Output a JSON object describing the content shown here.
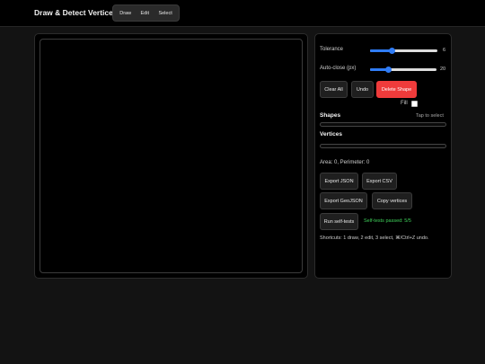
{
  "app": {
    "title": "Draw & Detect Vertices"
  },
  "modes": [
    {
      "label": "Draw"
    },
    {
      "label": "Edit"
    },
    {
      "label": "Select"
    }
  ],
  "controls": {
    "tolerance": {
      "label": "Tolerance",
      "value": "6",
      "level": 0.32
    },
    "autoclose": {
      "label": "Auto-close (px)",
      "value": "20",
      "level": 0.28
    },
    "clear_label": "Clear All",
    "undo_label": "Undo",
    "delete_label": "Delete Shape",
    "fill_label": "Fill"
  },
  "shapes": {
    "title": "Shapes",
    "hint": "Tap to select"
  },
  "vertices": {
    "title": "Vertices"
  },
  "metrics": {
    "text": "Area: 0, Perimeter: 0"
  },
  "exports": {
    "json_label": "Export JSON",
    "csv_label": "Export CSV",
    "geojson_label": "Export GeoJSON",
    "copy_label": "Copy vertices"
  },
  "tests": {
    "run_label": "Run self-tests",
    "status": "Self-tests passed: 5/5"
  },
  "shortcuts": {
    "text": "Shortcuts: 1 draw, 2 edit, 3 select, ⌘/Ctrl+Z undo."
  },
  "colors": {
    "accent": "#2f7cf6",
    "danger": "#ef3b3b",
    "success": "#3fd05a"
  }
}
